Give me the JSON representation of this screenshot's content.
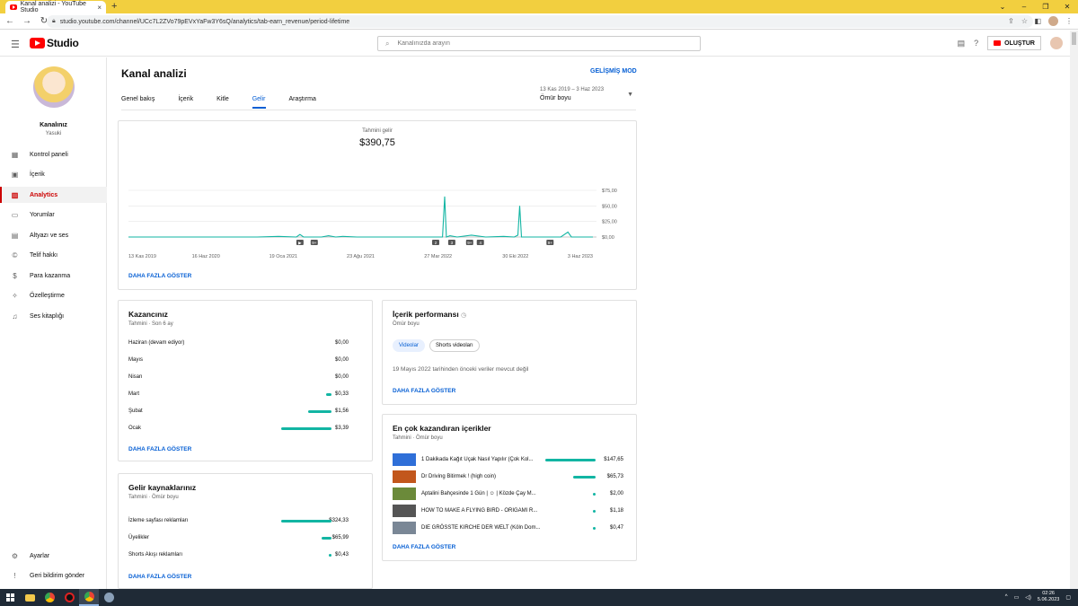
{
  "browser": {
    "tab_title": "Kanal analizi - YouTube Studio",
    "tab_close": "×",
    "new_tab": "+",
    "url": "studio.youtube.com/channel/UCc7L2ZVo79pEVxYaFw3Y6sQ/analytics/tab-earn_revenue/period-lifetime",
    "win_min": "–",
    "win_max": "❐",
    "win_close": "✕"
  },
  "header": {
    "logo_text": "Studio",
    "search_placeholder": "Kanalınızda arayın",
    "create_label": "OLUŞTUR"
  },
  "sidebar": {
    "channel_name": "Kanalınız",
    "channel_sub": "Yasuki",
    "items": [
      {
        "label": "Kontrol paneli",
        "icon": "dashboard-icon"
      },
      {
        "label": "İçerik",
        "icon": "content-icon"
      },
      {
        "label": "Analytics",
        "icon": "analytics-icon"
      },
      {
        "label": "Yorumlar",
        "icon": "comments-icon"
      },
      {
        "label": "Altyazı ve ses",
        "icon": "subtitles-icon"
      },
      {
        "label": "Telif hakkı",
        "icon": "copyright-icon"
      },
      {
        "label": "Para kazanma",
        "icon": "monetization-icon"
      },
      {
        "label": "Özelleştirme",
        "icon": "customization-icon"
      },
      {
        "label": "Ses kitaplığı",
        "icon": "audio-library-icon"
      }
    ],
    "bottom": [
      {
        "label": "Ayarlar",
        "icon": "settings-icon"
      },
      {
        "label": "Geri bildirim gönder",
        "icon": "feedback-icon"
      }
    ]
  },
  "main": {
    "title": "Kanal analizi",
    "advanced_mode": "GELİŞMİŞ MOD",
    "tabs": [
      "Genel bakış",
      "İçerik",
      "Kitle",
      "Gelir",
      "Araştırma"
    ],
    "active_tab": "Gelir",
    "date_range": "13 Kas 2019 – 3 Haz 2023",
    "period": "Ömür boyu"
  },
  "revenue_card": {
    "label": "Tahmini gelir",
    "value": "$390,75",
    "show_more": "DAHA FAZLA GÖSTER"
  },
  "chart_data": {
    "type": "line",
    "x_tick_labels": [
      "13 Kas 2019",
      "16 Haz 2020",
      "19 Oca 2021",
      "23 Ağu 2021",
      "27 Mar 2022",
      "30 Eki 2022",
      "3 Haz 2023"
    ],
    "y_tick_labels": [
      "$75,00",
      "$50,00",
      "$25,00",
      "$0,00"
    ],
    "ylim": [
      0,
      75
    ],
    "x_range": [
      0,
      1300
    ],
    "x": [
      0,
      60,
      120,
      180,
      240,
      300,
      360,
      420,
      470,
      480,
      490,
      540,
      560,
      580,
      600,
      640,
      700,
      760,
      820,
      880,
      879,
      885,
      890,
      900,
      920,
      960,
      1000,
      1050,
      1080,
      1090,
      1095,
      1100,
      1150,
      1210,
      1230,
      1240,
      1300
    ],
    "values": [
      0,
      0,
      0,
      0,
      0,
      0,
      0,
      1,
      0,
      4,
      0,
      0,
      2,
      0,
      1,
      0,
      0,
      0,
      0,
      0,
      0,
      65,
      0,
      2,
      0,
      3,
      0,
      1,
      0,
      3,
      50,
      0,
      0,
      0,
      8,
      0,
      0
    ],
    "markers": [
      {
        "label": "▶",
        "x": 480
      },
      {
        "label": "9+",
        "x": 520
      },
      {
        "label": "2",
        "x": 860
      },
      {
        "label": "3",
        "x": 905
      },
      {
        "label": "9+",
        "x": 955
      },
      {
        "label": "4",
        "x": 985
      },
      {
        "label": "9+",
        "x": 1180
      }
    ],
    "color": "#12b5a3"
  },
  "earnings_card": {
    "title": "Kazancınız",
    "subtitle": "Tahmini · Son 6 ay",
    "rows": [
      {
        "label": "Haziran (devam ediyor)",
        "value": "$0,00",
        "fraction": 0
      },
      {
        "label": "Mayıs",
        "value": "$0,00",
        "fraction": 0
      },
      {
        "label": "Nisan",
        "value": "$0,00",
        "fraction": 0
      },
      {
        "label": "Mart",
        "value": "$0,33",
        "fraction": 0.1
      },
      {
        "label": "Şubat",
        "value": "$1,56",
        "fraction": 0.46
      },
      {
        "label": "Ocak",
        "value": "$3,39",
        "fraction": 1
      }
    ],
    "show_more": "DAHA FAZLA GÖSTER"
  },
  "sources_card": {
    "title": "Gelir kaynaklarınız",
    "subtitle": "Tahmini · Ömür boyu",
    "rows": [
      {
        "label": "İzleme sayfası reklamları",
        "value": "$324,33",
        "fraction": 1
      },
      {
        "label": "Üyelikler",
        "value": "$65,99",
        "fraction": 0.2
      },
      {
        "label": "Shorts Akışı reklamları",
        "value": "$0,43",
        "fraction": 0.02
      }
    ],
    "show_more": "DAHA FAZLA GÖSTER"
  },
  "performance_card": {
    "title": "İçerik performansı",
    "subtitle": "Ömür boyu",
    "chips": [
      "Videolar",
      "Shorts videoları"
    ],
    "note": "19 Mayıs 2022 tarihinden önceki veriler mevcut değil",
    "show_more": "DAHA FAZLA GÖSTER"
  },
  "top_card": {
    "title": "En çok kazandıran içerikler",
    "subtitle": "Tahmini · Ömür boyu",
    "rows": [
      {
        "title": "1 Dakikada Kağıt Uçak Nasıl Yapılır (Çok Kol...",
        "value": "$147,65",
        "fraction": 1,
        "color": "#2f6fd8"
      },
      {
        "title": "Dr Driving Bitirmek ! (high coin)",
        "value": "$65,73",
        "fraction": 0.45,
        "color": "#c2571c"
      },
      {
        "title": "Aptalini Bahçesinde 1 Gün | ☺ | Közde Çay M...",
        "value": "$2,00",
        "fraction": 0.02,
        "color": "#6b8a3a"
      },
      {
        "title": "HOW TO MAKE A FLYING BIRD - ORIGAMI R...",
        "value": "$1,18",
        "fraction": 0.01,
        "color": "#555555"
      },
      {
        "title": "DIE GRÖSSTE KIRCHE DER WELT (Köln Dom...",
        "value": "$0,47",
        "fraction": 0.005,
        "color": "#7a8796"
      }
    ],
    "show_more": "DAHA FAZLA GÖSTER"
  },
  "taskbar": {
    "time": "02:26",
    "date": "5.06.2023"
  }
}
